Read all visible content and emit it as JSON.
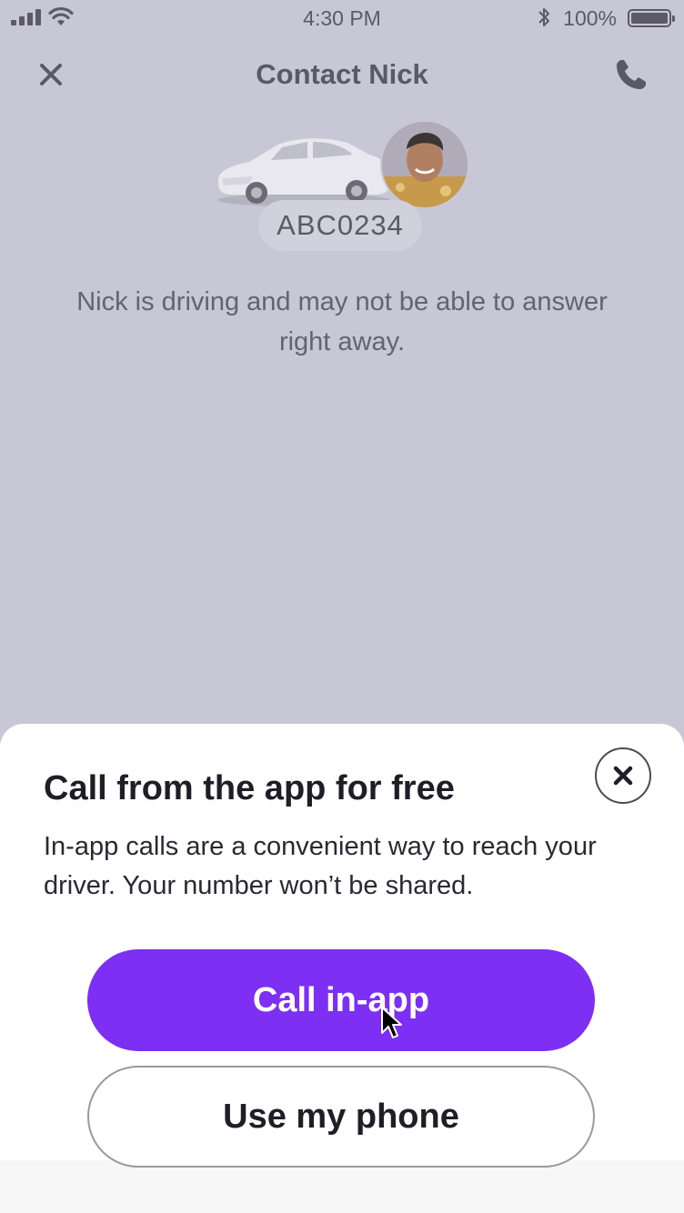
{
  "status_bar": {
    "time": "4:30 PM",
    "battery": "100%"
  },
  "header": {
    "title": "Contact Nick"
  },
  "driver": {
    "plate": "ABC0234",
    "message": "Nick is driving and may not be able to answer right away."
  },
  "sheet": {
    "title": "Call from the app for free",
    "body": "In-app calls are a convenient way to reach your driver. Your number won’t be shared.",
    "primary_button": "Call in-app",
    "secondary_button": "Use my phone"
  },
  "colors": {
    "accent": "#7d2ff4",
    "overlay": "#c8c7d5"
  }
}
